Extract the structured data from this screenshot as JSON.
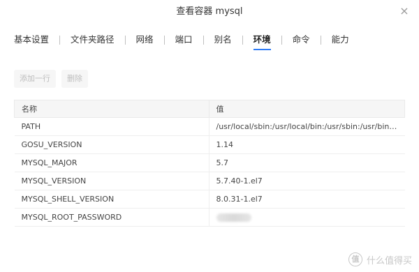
{
  "dialog": {
    "title": "查看容器 mysql",
    "close_icon": "×"
  },
  "tabs": [
    {
      "label": "基本设置"
    },
    {
      "label": "文件夹路径"
    },
    {
      "label": "网络"
    },
    {
      "label": "端口"
    },
    {
      "label": "别名"
    },
    {
      "label": "环境",
      "active": true
    },
    {
      "label": "命令"
    },
    {
      "label": "能力"
    }
  ],
  "toolbar": {
    "add_row_label": "添加一行",
    "delete_label": "删除"
  },
  "table": {
    "headers": [
      "名称",
      "值"
    ],
    "rows": [
      {
        "name": "PATH",
        "value": "/usr/local/sbin:/usr/local/bin:/usr/sbin:/usr/bin:/..."
      },
      {
        "name": "GOSU_VERSION",
        "value": "1.14"
      },
      {
        "name": "MYSQL_MAJOR",
        "value": "5.7"
      },
      {
        "name": "MYSQL_VERSION",
        "value": "5.7.40-1.el7"
      },
      {
        "name": "MYSQL_SHELL_VERSION",
        "value": "8.0.31-1.el7"
      },
      {
        "name": "MYSQL_ROOT_PASSWORD",
        "value": ""
      }
    ]
  },
  "watermark": {
    "logo_text": "值",
    "text": "什么值得买"
  },
  "colors": {
    "accent": "#2f7cf6"
  }
}
